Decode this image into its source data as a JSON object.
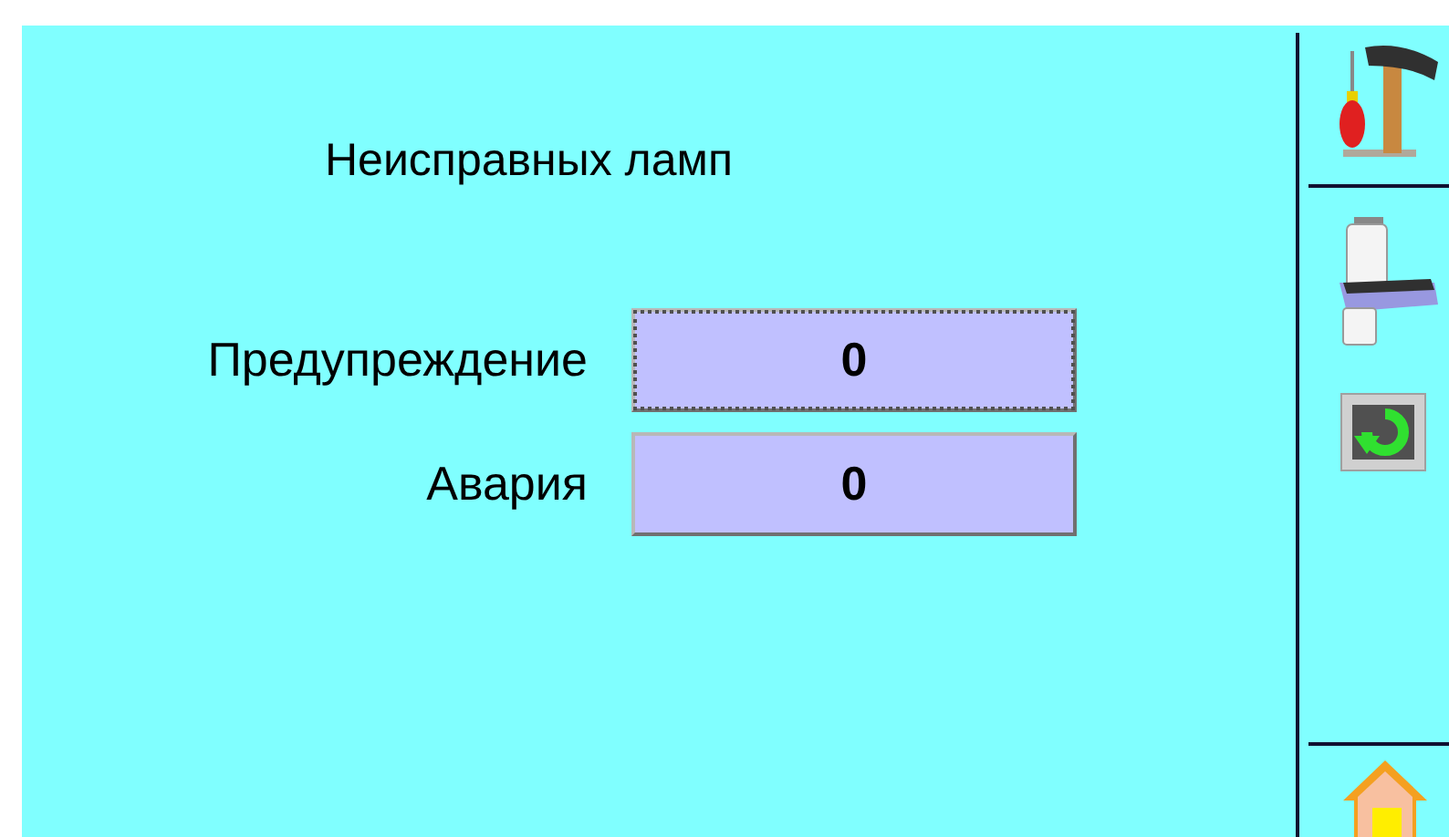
{
  "title": "Неисправных ламп",
  "fields": [
    {
      "label": "Предупреждение",
      "value": "0",
      "focused": true
    },
    {
      "label": "Авария",
      "value": "0",
      "focused": false
    }
  ],
  "toolbar": [
    {
      "kind": "tools"
    },
    {
      "kind": "lamp"
    },
    {
      "kind": "refresh"
    },
    {
      "kind": "home"
    }
  ]
}
